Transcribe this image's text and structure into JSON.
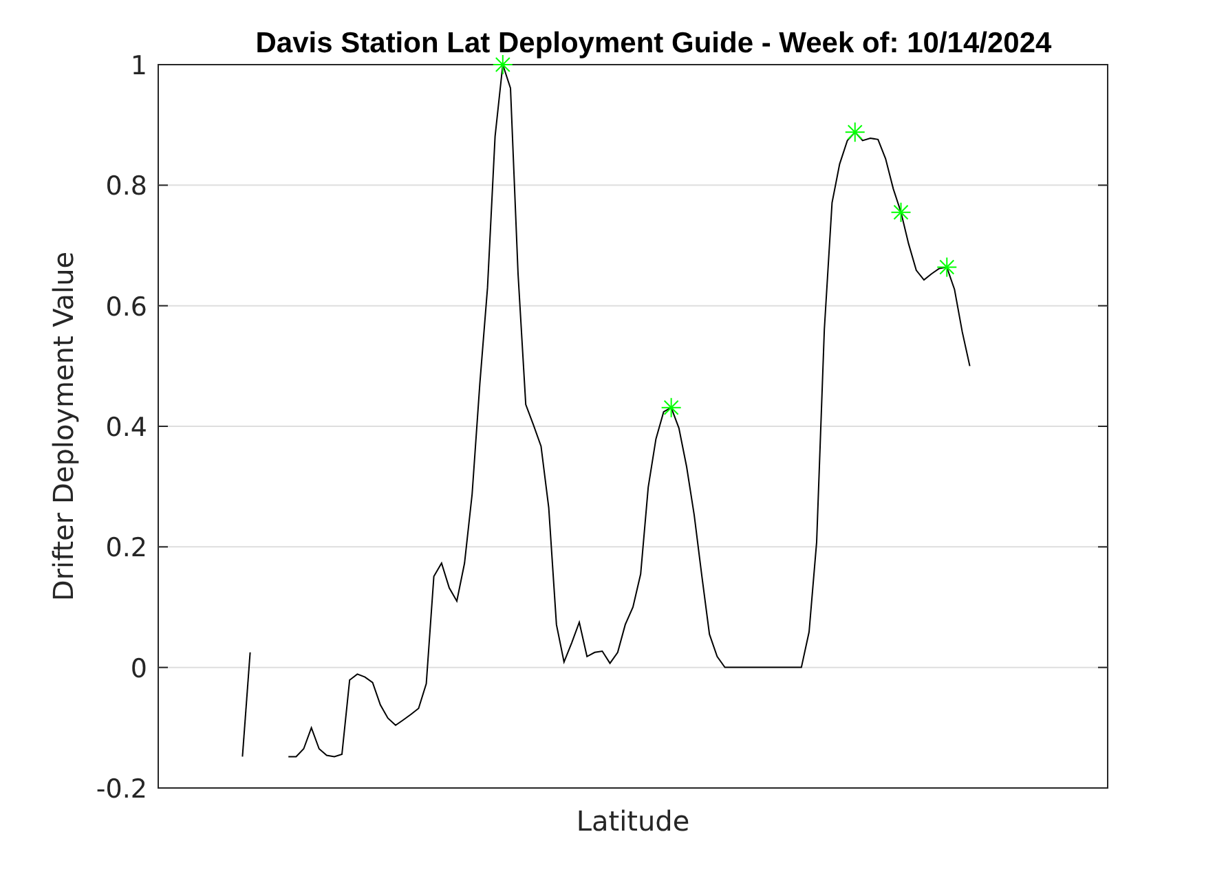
{
  "figure": {
    "chart_data": {
      "type": "line",
      "title": "Davis Station Lat Deployment Guide - Week of: 10/14/2024",
      "xlabel": "Latitude",
      "ylabel": "Drifter Deployment Value",
      "ylim": [
        -0.2,
        1
      ],
      "grid": true,
      "yticks": [
        {
          "value": -0.2,
          "label": "-0.2"
        },
        {
          "value": 0,
          "label": "0"
        },
        {
          "value": 0.2,
          "label": "0.2"
        },
        {
          "value": 0.4,
          "label": "0.4"
        },
        {
          "value": 0.6,
          "label": "0.6"
        },
        {
          "value": 0.8,
          "label": "0.8"
        },
        {
          "value": 1,
          "label": "1"
        }
      ],
      "categories": [
        null,
        null,
        null,
        null,
        null,
        null,
        null,
        null,
        null,
        null,
        null,
        null,
        null,
        null,
        null,
        null,
        null,
        null,
        null,
        null,
        null,
        null,
        null,
        null,
        null,
        null,
        null,
        null,
        null,
        null,
        null,
        null,
        null,
        null,
        null,
        null,
        null,
        null,
        null,
        null,
        null,
        null,
        null,
        null,
        null,
        null,
        null,
        null,
        null,
        null,
        null,
        null,
        null,
        null,
        null,
        null,
        null,
        null,
        null,
        null,
        null,
        null,
        null,
        null,
        null,
        null,
        null,
        null,
        null,
        null,
        null,
        null,
        null,
        null,
        null,
        null,
        null,
        null,
        null,
        null,
        null,
        null,
        null,
        null,
        null,
        null,
        null,
        null,
        null,
        null,
        null,
        null,
        null,
        null,
        null,
        null,
        null,
        null,
        null,
        null,
        null,
        null,
        null,
        null,
        null,
        null,
        null,
        null,
        null,
        null,
        null,
        null,
        null,
        null,
        null,
        null,
        null,
        null,
        null,
        null,
        null,
        null,
        null,
        null,
        null
      ],
      "series": [
        {
          "color": "#000000",
          "values": [
            null,
            null,
            null,
            null,
            null,
            null,
            null,
            null,
            null,
            null,
            null,
            -0.148,
            0.025,
            null,
            null,
            null,
            null,
            null,
            null,
            null,
            null,
            null,
            null,
            null,
            null,
            null,
            null,
            null,
            null,
            null,
            null,
            null,
            null,
            null,
            null,
            null,
            null,
            null,
            null,
            null,
            null,
            null,
            null,
            null,
            null,
            null,
            null,
            null,
            null,
            null,
            null,
            null,
            null,
            null,
            null,
            null,
            null,
            null,
            null,
            null,
            null,
            null,
            null,
            null,
            null,
            null,
            null,
            null,
            null,
            null,
            null,
            null,
            null,
            null,
            null,
            null,
            null,
            null,
            null,
            null,
            null,
            null,
            null,
            null,
            null,
            null,
            null,
            null,
            null,
            null,
            null,
            null,
            null,
            null,
            null,
            null,
            null,
            null,
            null,
            null,
            null,
            null,
            null,
            null,
            null,
            null,
            null,
            null,
            null,
            null,
            null,
            null,
            null,
            null,
            null,
            null,
            null,
            null,
            null,
            null,
            null,
            null,
            null,
            null,
            null
          ]
        },
        {
          "color": "#000000",
          "values": [
            null,
            null,
            null,
            null,
            null,
            null,
            null,
            null,
            null,
            null,
            null,
            null,
            null,
            null,
            null,
            null,
            null,
            -0.148,
            -0.148,
            -0.135,
            -0.1,
            -0.135,
            -0.146,
            -0.148,
            -0.144,
            -0.021,
            -0.011,
            -0.016,
            -0.025,
            -0.062,
            -0.084,
            -0.096,
            -0.087,
            -0.078,
            -0.068,
            -0.027,
            0.151,
            0.173,
            0.132,
            0.11,
            0.173,
            0.287,
            0.47,
            0.63,
            0.881,
            1.0,
            0.961,
            0.653,
            0.436,
            0.402,
            0.367,
            0.265,
            0.071,
            0.009,
            0.041,
            0.075,
            0.018,
            0.025,
            0.027,
            0.007,
            0.025,
            0.071,
            0.1,
            0.155,
            0.299,
            0.379,
            0.424,
            0.431,
            0.397,
            0.333,
            0.253,
            0.151,
            0.055,
            0.018,
            0,
            0,
            0,
            0,
            0,
            0,
            0,
            0,
            0,
            0,
            0,
            0.059,
            0.208,
            0.561,
            0.771,
            0.835,
            0.874,
            0.888,
            0.874,
            0.878,
            0.876,
            0.844,
            0.794,
            0.755,
            0.703,
            0.659,
            0.643,
            0.653,
            0.662,
            0.664,
            0.627,
            0.557,
            0.5,
            null,
            null,
            null,
            null,
            null,
            null,
            null,
            null,
            null,
            null,
            null,
            null,
            null,
            null,
            null,
            null,
            null,
            null
          ]
        },
        {
          "color": "#00ff00",
          "marker": "cross",
          "values": [
            null,
            null,
            null,
            null,
            null,
            null,
            null,
            null,
            null,
            null,
            null,
            null,
            null,
            null,
            null,
            null,
            null,
            null,
            null,
            null,
            null,
            null,
            null,
            null,
            null,
            null,
            null,
            null,
            null,
            null,
            null,
            null,
            null,
            null,
            null,
            null,
            null,
            null,
            null,
            null,
            null,
            null,
            null,
            null,
            null,
            1.0,
            null,
            null,
            null,
            null,
            null,
            null,
            null,
            null,
            null,
            null,
            null,
            null,
            null,
            null,
            null,
            null,
            null,
            null,
            null,
            null,
            null,
            0.431,
            null,
            null,
            null,
            null,
            null,
            null,
            null,
            null,
            null,
            null,
            null,
            null,
            null,
            null,
            null,
            null,
            null,
            null,
            null,
            null,
            null,
            null,
            null,
            0.888,
            null,
            null,
            null,
            null,
            null,
            0.755,
            null,
            null,
            null,
            null,
            null,
            0.664,
            null,
            null,
            null,
            null,
            null,
            null,
            null,
            null,
            null,
            null,
            null,
            null,
            null,
            null,
            null,
            null,
            null,
            null,
            null,
            null,
            null
          ]
        }
      ]
    }
  }
}
